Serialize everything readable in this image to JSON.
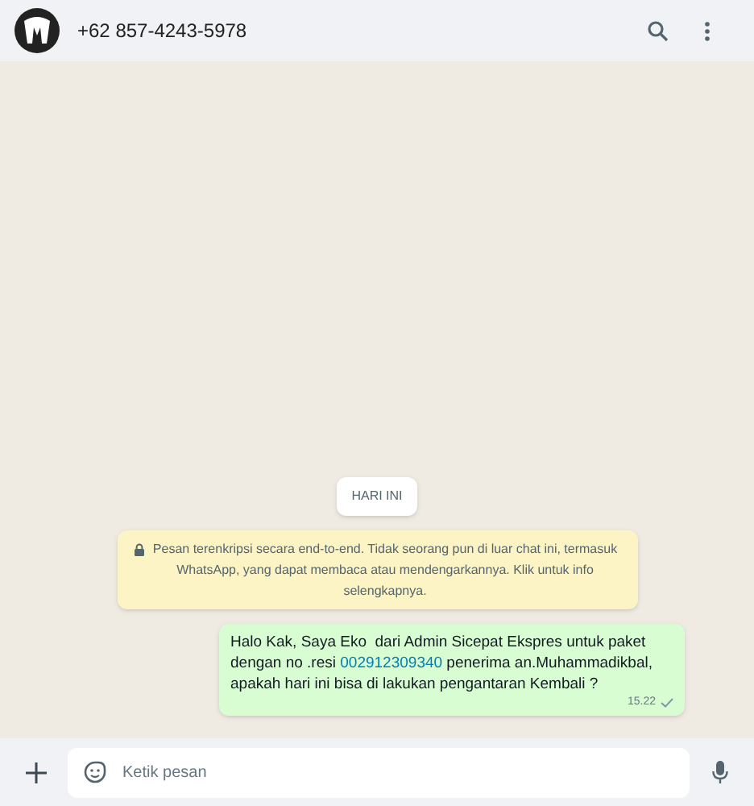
{
  "header": {
    "contact": "+62 857-4243-5978"
  },
  "date_chip": "HARI INI",
  "encryption_notice": "Pesan terenkripsi secara end-to-end. Tidak seorang pun di luar chat ini, termasuk WhatsApp, yang dapat membaca atau mendengarkannya. Klik untuk info selengkapnya.",
  "messages": [
    {
      "text_before": "Halo Kak, Saya Eko  dari Admin Sicepat Ekspres untuk paket dengan no .resi ",
      "link": "002912309340",
      "text_after": " penerima an.Muhammadikbal, apakah hari ini bisa di lakukan pengantaran Kembali ?",
      "time": "15.22",
      "read": false
    }
  ],
  "composer": {
    "placeholder": "Ketik pesan"
  }
}
